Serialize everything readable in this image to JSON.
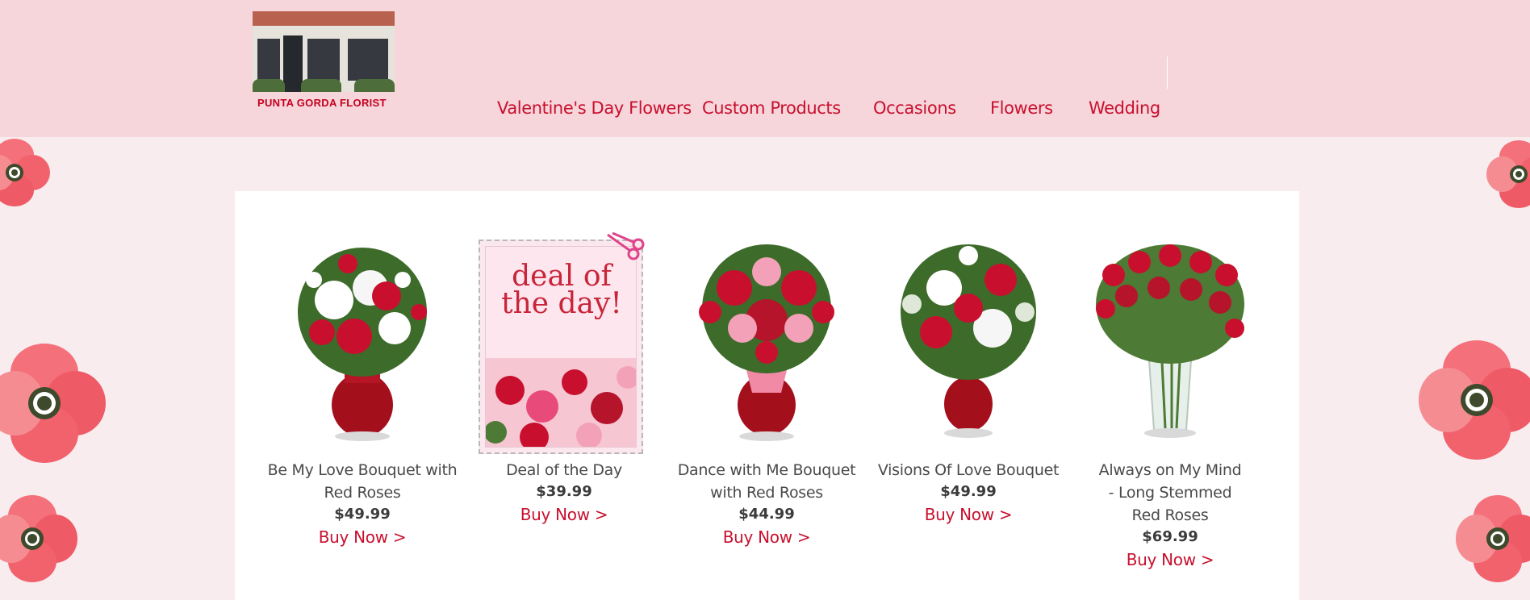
{
  "site": {
    "logo_text": "PUNTA GORDA FLORIST"
  },
  "nav": {
    "items": [
      "Valentine's Day Flowers",
      "Custom Products",
      "Occasions",
      "Flowers",
      "Wedding"
    ]
  },
  "colors": {
    "header_bg": "#f7d6db",
    "page_bg": "#f8ecef",
    "accent": "#c8102e"
  },
  "products": [
    {
      "name": "Be My Love Bouquet with Red Roses",
      "price": "$49.99",
      "cta": "Buy Now >"
    },
    {
      "name": "Deal of the Day",
      "price": "$39.99",
      "cta": "Buy Now >",
      "image_text": "deal of the day!"
    },
    {
      "name": "Dance with Me Bouquet with Red Roses",
      "price": "$44.99",
      "cta": "Buy Now >"
    },
    {
      "name": "Visions Of Love Bouquet",
      "price": "$49.99",
      "cta": "Buy Now >"
    },
    {
      "name": "Always on My Mind - Long Stemmed Red Roses",
      "price": "$69.99",
      "cta": "Buy Now >"
    }
  ],
  "icons": [
    "scissors-icon",
    "poppy-flower-decoration"
  ]
}
